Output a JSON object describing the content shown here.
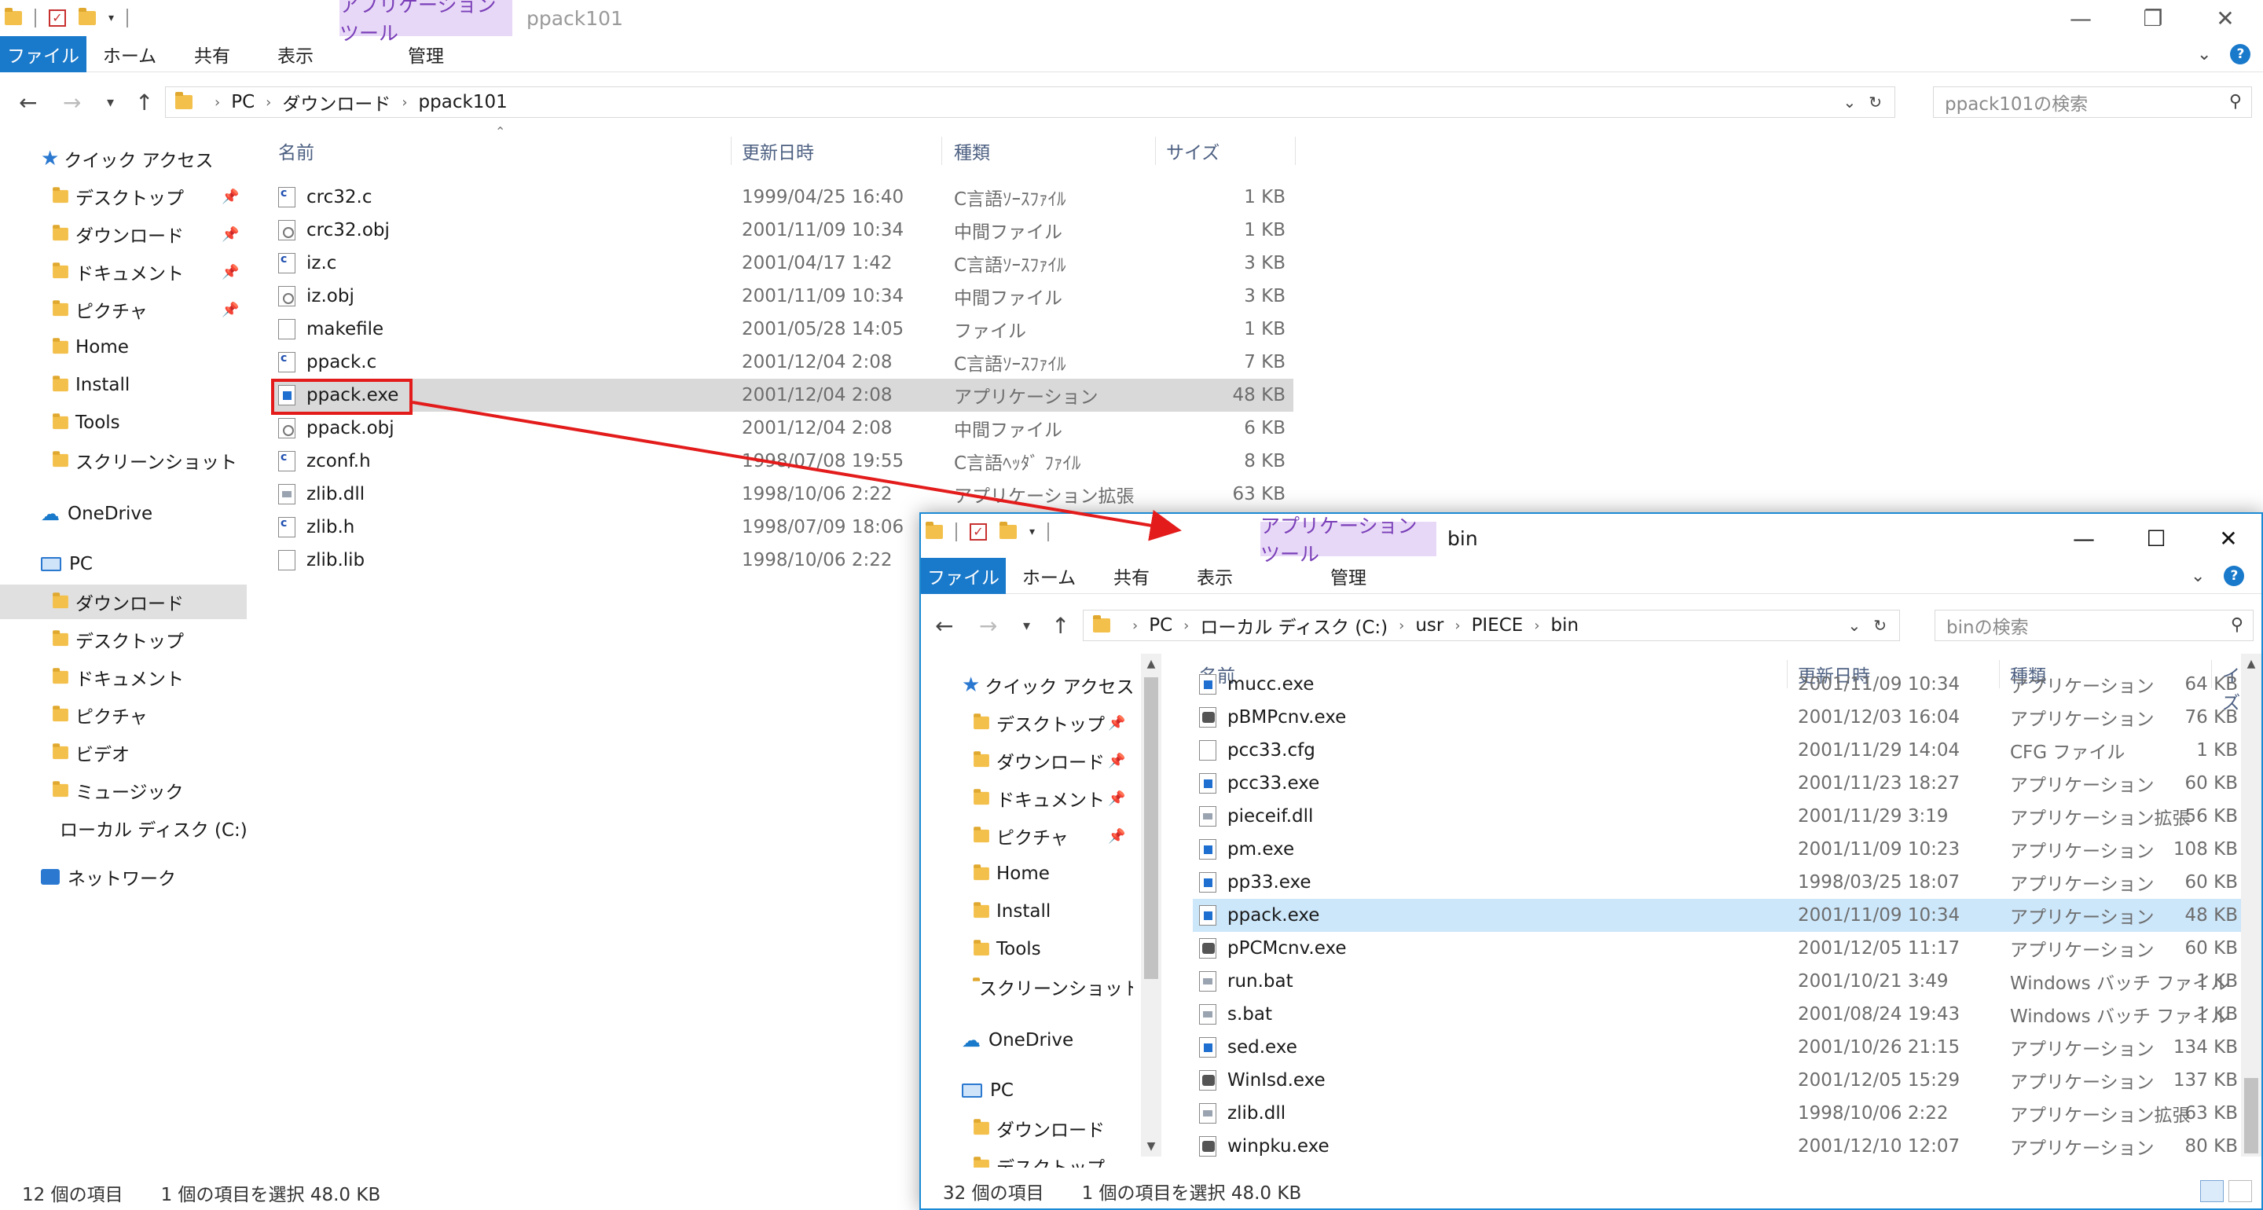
{
  "back_window": {
    "qat_caret": "▾",
    "context_tab": "アプリケーション ツール",
    "title": "ppack101",
    "controls": {
      "minimize": "—",
      "maximize": "❐",
      "close": "✕"
    },
    "ribbon_tabs": [
      "ファイル",
      "ホーム",
      "共有",
      "表示",
      "管理"
    ],
    "nav": {
      "back": "←",
      "forward": "→",
      "recent": "▾",
      "up": "↑"
    },
    "breadcrumb": [
      "PC",
      "ダウンロード",
      "ppack101"
    ],
    "crumb_sep": "›",
    "search_placeholder": "ppack101の検索",
    "nav_pane": [
      {
        "label": "クイック アクセス",
        "kind": "quick"
      },
      {
        "label": "デスクトップ",
        "kind": "folder",
        "pinned": true
      },
      {
        "label": "ダウンロード",
        "kind": "folder",
        "pinned": true
      },
      {
        "label": "ドキュメント",
        "kind": "folder",
        "pinned": true
      },
      {
        "label": "ピクチャ",
        "kind": "folder",
        "pinned": true
      },
      {
        "label": "Home",
        "kind": "folder"
      },
      {
        "label": "Install",
        "kind": "folder"
      },
      {
        "label": "Tools",
        "kind": "folder"
      },
      {
        "label": "スクリーンショット",
        "kind": "folder"
      },
      {
        "label": "OneDrive",
        "kind": "cloud"
      },
      {
        "label": "PC",
        "kind": "pc"
      },
      {
        "label": "ダウンロード",
        "kind": "folder",
        "selected": true
      },
      {
        "label": "デスクトップ",
        "kind": "folder"
      },
      {
        "label": "ドキュメント",
        "kind": "folder"
      },
      {
        "label": "ピクチャ",
        "kind": "folder"
      },
      {
        "label": "ビデオ",
        "kind": "folder"
      },
      {
        "label": "ミュージック",
        "kind": "folder"
      },
      {
        "label": "ローカル ディスク (C:)",
        "kind": "drive"
      },
      {
        "label": "ネットワーク",
        "kind": "net"
      }
    ],
    "columns": [
      "名前",
      "更新日時",
      "種類",
      "サイズ"
    ],
    "files": [
      {
        "name": "crc32.c",
        "date": "1999/04/25 16:40",
        "type": "C言語ｿｰｽﾌｧｲﾙ",
        "size": "1 KB",
        "icon": "src"
      },
      {
        "name": "crc32.obj",
        "date": "2001/11/09 10:34",
        "type": "中間ファイル",
        "size": "1 KB",
        "icon": "obj"
      },
      {
        "name": "iz.c",
        "date": "2001/04/17 1:42",
        "type": "C言語ｿｰｽﾌｧｲﾙ",
        "size": "3 KB",
        "icon": "src"
      },
      {
        "name": "iz.obj",
        "date": "2001/11/09 10:34",
        "type": "中間ファイル",
        "size": "3 KB",
        "icon": "obj"
      },
      {
        "name": "makefile",
        "date": "2001/05/28 14:05",
        "type": "ファイル",
        "size": "1 KB",
        "icon": "blank"
      },
      {
        "name": "ppack.c",
        "date": "2001/12/04 2:08",
        "type": "C言語ｿｰｽﾌｧｲﾙ",
        "size": "7 KB",
        "icon": "src"
      },
      {
        "name": "ppack.exe",
        "date": "2001/12/04 2:08",
        "type": "アプリケーション",
        "size": "48 KB",
        "icon": "exe",
        "selected": true
      },
      {
        "name": "ppack.obj",
        "date": "2001/12/04 2:08",
        "type": "中間ファイル",
        "size": "6 KB",
        "icon": "obj"
      },
      {
        "name": "zconf.h",
        "date": "1998/07/08 19:55",
        "type": "C言語ﾍｯﾀﾞ ﾌｧｲﾙ",
        "size": "8 KB",
        "icon": "src"
      },
      {
        "name": "zlib.dll",
        "date": "1998/10/06 2:22",
        "type": "アプリケーション拡張",
        "size": "63 KB",
        "icon": "dll"
      },
      {
        "name": "zlib.h",
        "date": "1998/07/09 18:06",
        "type": "",
        "size": "",
        "icon": "src"
      },
      {
        "name": "zlib.lib",
        "date": "1998/10/06 2:22",
        "type": "",
        "size": "",
        "icon": "blank"
      }
    ],
    "status": {
      "count": "12 個の項目",
      "selection": "1 個の項目を選択  48.0 KB"
    }
  },
  "front_window": {
    "qat_caret": "▾",
    "context_tab": "アプリケーション ツール",
    "title": "bin",
    "controls": {
      "minimize": "—",
      "maximize": "☐",
      "close": "✕"
    },
    "ribbon_tabs": [
      "ファイル",
      "ホーム",
      "共有",
      "表示",
      "管理"
    ],
    "nav": {
      "back": "←",
      "forward": "→",
      "recent": "▾",
      "up": "↑"
    },
    "breadcrumb": [
      "PC",
      "ローカル ディスク (C:)",
      "usr",
      "PIECE",
      "bin"
    ],
    "crumb_sep": "›",
    "search_placeholder": "binの検索",
    "nav_pane": [
      {
        "label": "クイック アクセス",
        "kind": "quick"
      },
      {
        "label": "デスクトップ",
        "kind": "folder",
        "pinned": true
      },
      {
        "label": "ダウンロード",
        "kind": "folder",
        "pinned": true
      },
      {
        "label": "ドキュメント",
        "kind": "folder",
        "pinned": true
      },
      {
        "label": "ピクチャ",
        "kind": "folder",
        "pinned": true
      },
      {
        "label": "Home",
        "kind": "folder"
      },
      {
        "label": "Install",
        "kind": "folder"
      },
      {
        "label": "Tools",
        "kind": "folder"
      },
      {
        "label": "スクリーンショット",
        "kind": "folder"
      },
      {
        "label": "OneDrive",
        "kind": "cloud"
      },
      {
        "label": "PC",
        "kind": "pc"
      },
      {
        "label": "ダウンロード",
        "kind": "folder"
      },
      {
        "label": "デスクトップ",
        "kind": "folder"
      }
    ],
    "columns": [
      "名前",
      "更新日時",
      "種類",
      "サイズ"
    ],
    "files": [
      {
        "name": "mucc.exe",
        "date": "2001/11/09 10:34",
        "type": "アプリケーション",
        "size": "64 KB",
        "icon": "exe"
      },
      {
        "name": "pBMPcnv.exe",
        "date": "2001/12/03 16:04",
        "type": "アプリケーション",
        "size": "76 KB",
        "icon": "app"
      },
      {
        "name": "pcc33.cfg",
        "date": "2001/11/29 14:04",
        "type": "CFG ファイル",
        "size": "1 KB",
        "icon": "blank"
      },
      {
        "name": "pcc33.exe",
        "date": "2001/11/23 18:27",
        "type": "アプリケーション",
        "size": "60 KB",
        "icon": "exe"
      },
      {
        "name": "pieceif.dll",
        "date": "2001/11/29 3:19",
        "type": "アプリケーション拡張",
        "size": "56 KB",
        "icon": "dll"
      },
      {
        "name": "pm.exe",
        "date": "2001/11/09 10:23",
        "type": "アプリケーション",
        "size": "108 KB",
        "icon": "exe"
      },
      {
        "name": "pp33.exe",
        "date": "1998/03/25 18:07",
        "type": "アプリケーション",
        "size": "60 KB",
        "icon": "exe"
      },
      {
        "name": "ppack.exe",
        "date": "2001/11/09 10:34",
        "type": "アプリケーション",
        "size": "48 KB",
        "icon": "exe",
        "selected": true
      },
      {
        "name": "pPCMcnv.exe",
        "date": "2001/12/05 11:17",
        "type": "アプリケーション",
        "size": "60 KB",
        "icon": "app"
      },
      {
        "name": "run.bat",
        "date": "2001/10/21 3:49",
        "type": "Windows バッチ ファイル",
        "size": "1 KB",
        "icon": "dll"
      },
      {
        "name": "s.bat",
        "date": "2001/08/24 19:43",
        "type": "Windows バッチ ファイル",
        "size": "1 KB",
        "icon": "dll"
      },
      {
        "name": "sed.exe",
        "date": "2001/10/26 21:15",
        "type": "アプリケーション",
        "size": "134 KB",
        "icon": "exe"
      },
      {
        "name": "WinIsd.exe",
        "date": "2001/12/05 15:29",
        "type": "アプリケーション",
        "size": "137 KB",
        "icon": "app"
      },
      {
        "name": "zlib.dll",
        "date": "1998/10/06 2:22",
        "type": "アプリケーション拡張",
        "size": "63 KB",
        "icon": "dll"
      },
      {
        "name": "winpku.exe",
        "date": "2001/12/10 12:07",
        "type": "アプリケーション",
        "size": "80 KB",
        "icon": "app"
      }
    ],
    "status": {
      "count": "32 個の項目",
      "selection": "1 個の項目を選択  48.0 KB"
    }
  },
  "colors": {
    "accent": "#1979ca",
    "context_tab_bg": "#e8d8f7",
    "annotation": "#e31b1b",
    "selection_gray": "#d9d9d9",
    "selection_blue": "#cce6fa"
  }
}
